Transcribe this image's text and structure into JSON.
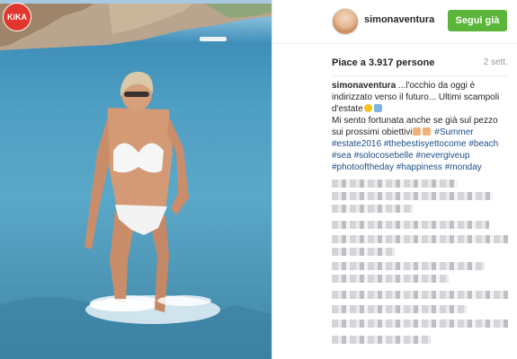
{
  "photo": {
    "watermark": "KiKA",
    "alt_icon": "bikini-beach-photo"
  },
  "header": {
    "username": "simonaventura",
    "follow_label": "Segui già"
  },
  "post": {
    "likes": "Piace a 3.917 persone",
    "time": "2 sett.",
    "caption_user": "simonaventura",
    "caption_line1": " ...l'occhio da oggi è indirizzato verso il futuro... Ultimi scampoli d'estate",
    "caption_line2": "Mi sento fortunata anche se già sul pezzo sui prossimi obiettivi",
    "hashtags": [
      "#Summer",
      "#estate2016",
      "#thebestisyettocome",
      "#beach",
      "#sea",
      "#solocosebelle",
      "#nevergiveup",
      "#photooftheday",
      "#happiness",
      "#monday"
    ]
  },
  "colors": {
    "follow_button": "#5bb53a",
    "hashtag": "#1e4f88",
    "watermark": "#e0362d"
  }
}
